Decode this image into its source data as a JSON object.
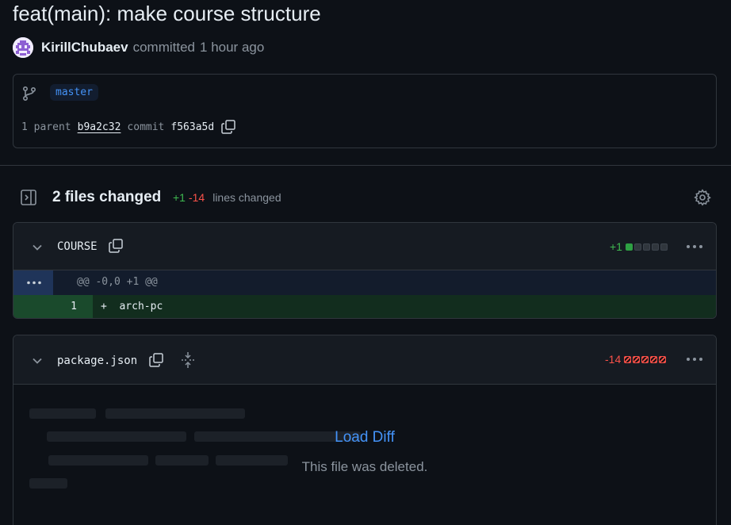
{
  "commit": {
    "title": "feat(main): make course structure",
    "author": "KirillChubaev",
    "action": "committed",
    "time": "1 hour ago",
    "branch": "master",
    "parent_count_label": "1 parent",
    "parent_hash": "b9a2c32",
    "commit_label": "commit",
    "commit_hash": "f563a5d"
  },
  "summary": {
    "files_changed": "2 files changed",
    "additions": "+1",
    "deletions": "-14",
    "lines_changed_label": "lines changed"
  },
  "files": [
    {
      "name": "COURSE",
      "stat": "+1",
      "diffstat_blocks": [
        "green",
        "gray",
        "gray",
        "gray",
        "gray"
      ],
      "hunk_header": "@@ -0,0 +1 @@",
      "lines": [
        {
          "number": "1",
          "sign": "+",
          "code": "arch-pc"
        }
      ]
    },
    {
      "name": "package.json",
      "stat": "-14",
      "diffstat_blocks": [
        "red",
        "red",
        "red",
        "red",
        "red"
      ],
      "load_diff_label": "Load Diff",
      "deleted_message": "This file was deleted."
    }
  ],
  "icons": {
    "branch": "git-branch-icon",
    "copy": "copy-icon",
    "sidebar": "sidebar-expand-icon",
    "settings": "gear-icon",
    "collapse": "chevron-down-icon",
    "expand": "unfold-icon",
    "more": "kebab-horizontal-icon"
  },
  "colors": {
    "background": "#0d1117",
    "border": "#30363d",
    "addition": "#3fb950",
    "deletion": "#f85149",
    "accent": "#4493f8"
  }
}
